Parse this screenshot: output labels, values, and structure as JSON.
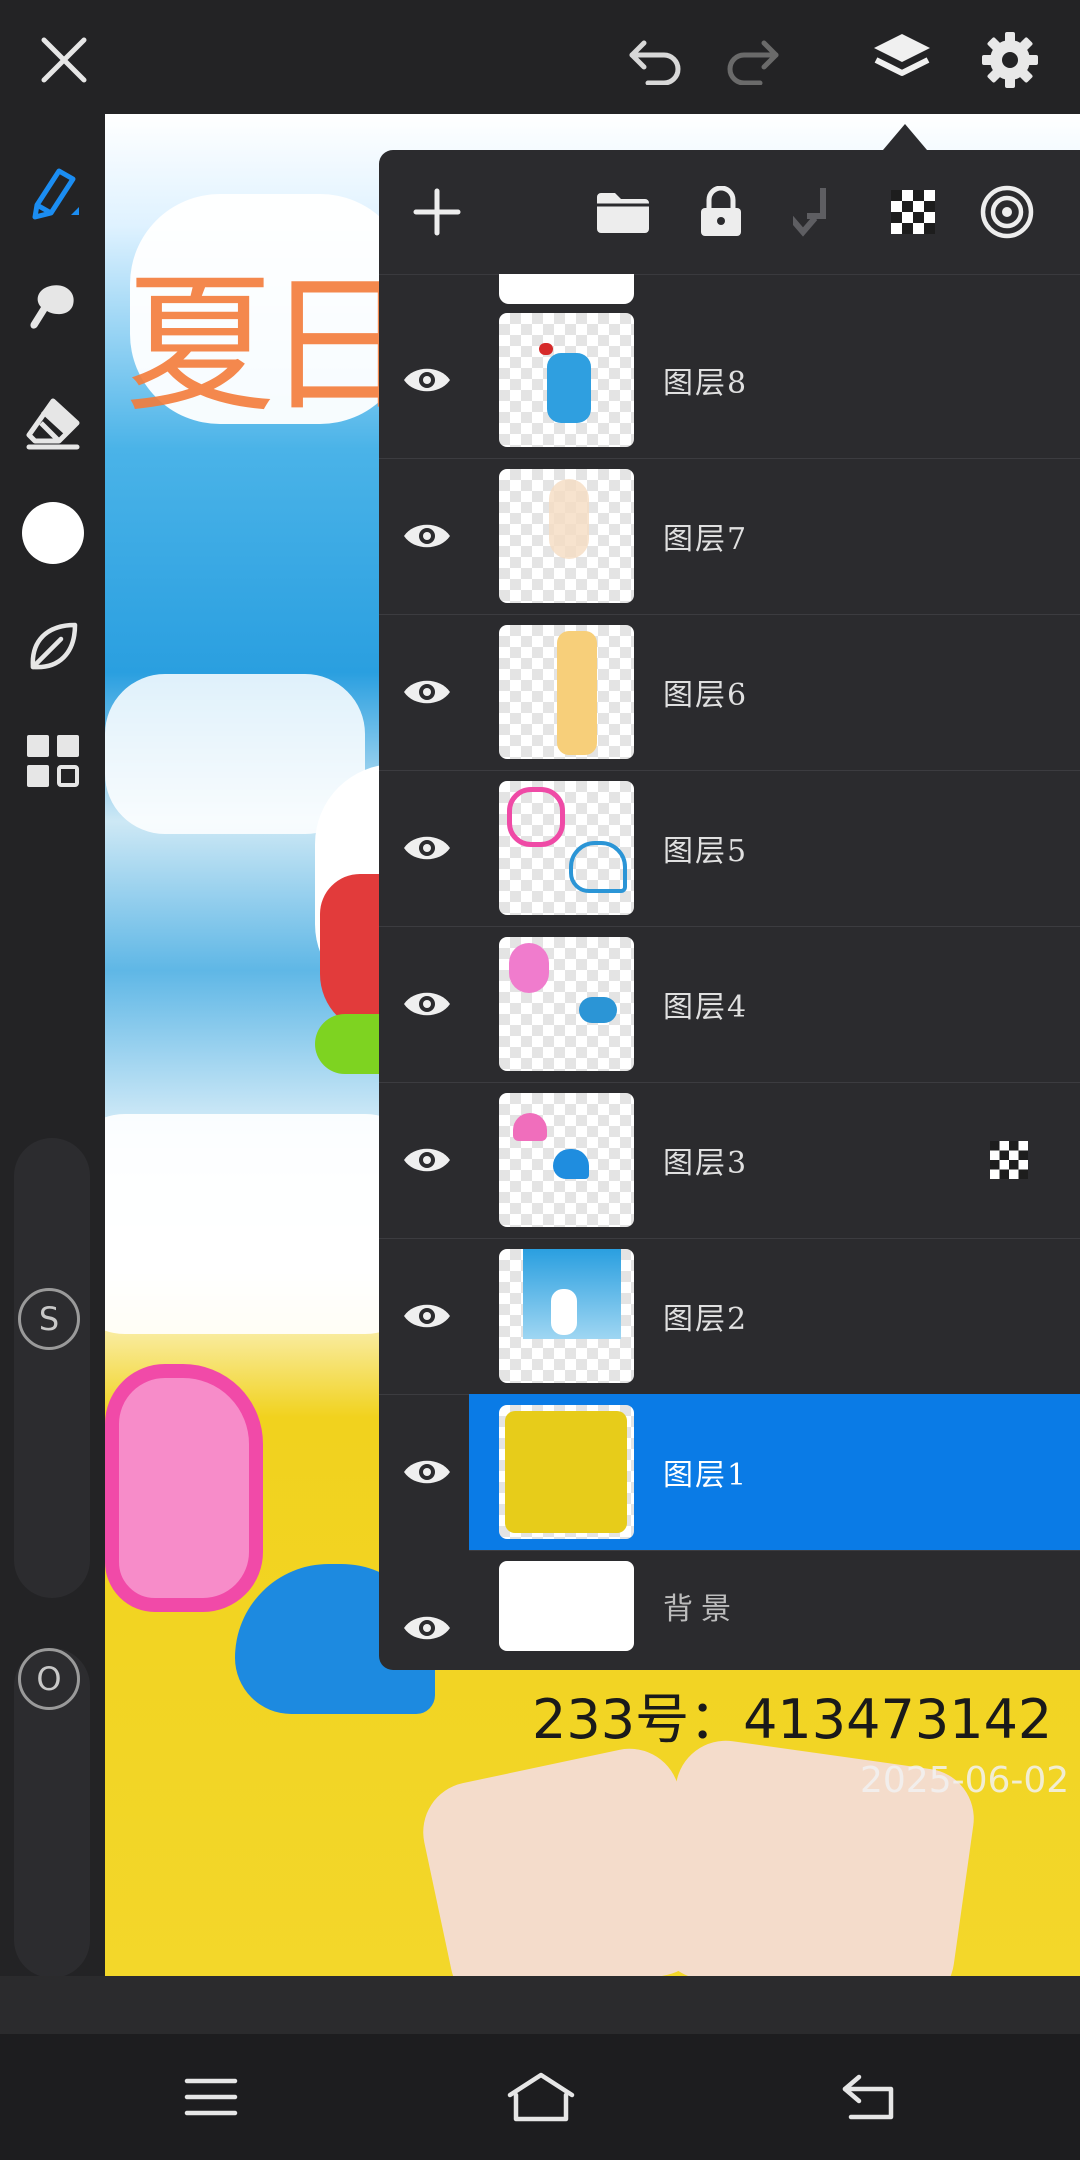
{
  "topbar": {
    "close_icon": "close-icon",
    "undo_icon": "undo-icon",
    "redo_icon": "redo-icon",
    "layers_icon": "layers-icon",
    "settings_icon": "gear-icon"
  },
  "left_tools": [
    {
      "name": "brush",
      "icon": "pen-icon",
      "active": true
    },
    {
      "name": "smudge",
      "icon": "smudge-icon"
    },
    {
      "name": "eraser",
      "icon": "eraser-icon"
    },
    {
      "name": "color",
      "icon": "color-swatch",
      "color": "#ffffff"
    },
    {
      "name": "shape",
      "icon": "leaf-icon"
    },
    {
      "name": "menu",
      "icon": "grid-icon"
    }
  ],
  "sliders": {
    "size_label": "S",
    "opacity_label": "O"
  },
  "canvas": {
    "title_text": "夏日",
    "watermark": "233号：413473142",
    "date_watermark": "2025-06-02"
  },
  "layer_panel": {
    "toolbar": [
      "add-icon",
      "folder-icon",
      "lock-icon",
      "merge-down-icon",
      "alpha-lock-icon",
      "blend-icon"
    ],
    "layers": [
      {
        "name": "图层8",
        "visible": true,
        "selected": false
      },
      {
        "name": "图层7",
        "visible": true,
        "selected": false
      },
      {
        "name": "图层6",
        "visible": true,
        "selected": false
      },
      {
        "name": "图层5",
        "visible": true,
        "selected": false
      },
      {
        "name": "图层4",
        "visible": true,
        "selected": false
      },
      {
        "name": "图层3",
        "visible": true,
        "selected": false,
        "alpha_lock": true
      },
      {
        "name": "图层2",
        "visible": true,
        "selected": false
      },
      {
        "name": "图层1",
        "visible": true,
        "selected": true
      }
    ],
    "background": {
      "name": "背景",
      "visible": true
    }
  },
  "colors": {
    "accent": "#0a7be6",
    "panel": "#2b2b2e",
    "toolbar": "#232325"
  },
  "navbar": [
    "menu-icon",
    "home-icon",
    "back-icon"
  ]
}
